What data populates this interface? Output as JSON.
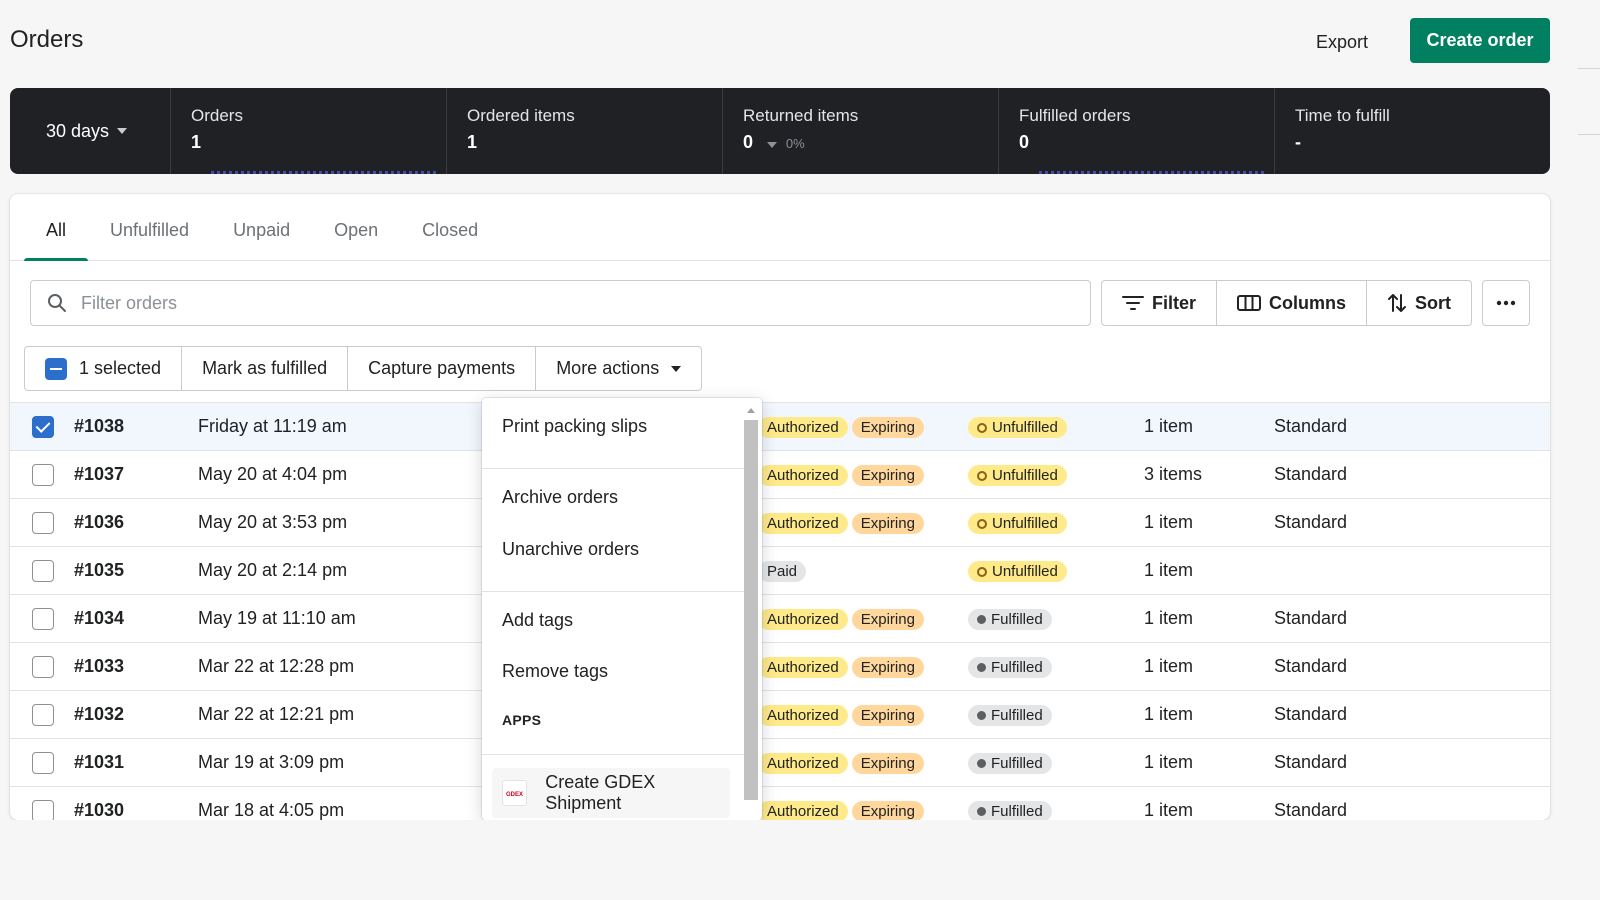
{
  "header": {
    "title": "Orders",
    "export_label": "Export",
    "create_label": "Create order"
  },
  "analytics": {
    "period": "30 days",
    "metrics": [
      {
        "label": "Orders",
        "value": "1",
        "delta": ""
      },
      {
        "label": "Ordered items",
        "value": "1",
        "delta": ""
      },
      {
        "label": "Returned items",
        "value": "0",
        "delta": "0%"
      },
      {
        "label": "Fulfilled orders",
        "value": "0",
        "delta": ""
      },
      {
        "label": "Time to fulfill",
        "value": "-",
        "delta": ""
      }
    ]
  },
  "tabs": [
    "All",
    "Unfulfilled",
    "Unpaid",
    "Open",
    "Closed"
  ],
  "search": {
    "placeholder": "Filter orders"
  },
  "toolbar": {
    "filter": "Filter",
    "columns": "Columns",
    "sort": "Sort"
  },
  "bulk": {
    "selected": "1 selected",
    "mark_fulfilled": "Mark as fulfilled",
    "capture": "Capture payments",
    "more": "More actions"
  },
  "orders": [
    {
      "id": "#1038",
      "date": "Friday at 11:19 am",
      "payment": "Authorized",
      "expiring": "Expiring",
      "fulfillment": "Unfulfilled",
      "items": "1 item",
      "delivery": "Standard",
      "checked": true
    },
    {
      "id": "#1037",
      "date": "May 20 at 4:04 pm",
      "payment": "Authorized",
      "expiring": "Expiring",
      "fulfillment": "Unfulfilled",
      "items": "3 items",
      "delivery": "Standard",
      "checked": false
    },
    {
      "id": "#1036",
      "date": "May 20 at 3:53 pm",
      "payment": "Authorized",
      "expiring": "Expiring",
      "fulfillment": "Unfulfilled",
      "items": "1 item",
      "delivery": "Standard",
      "checked": false
    },
    {
      "id": "#1035",
      "date": "May 20 at 2:14 pm",
      "payment": "Paid",
      "expiring": "",
      "fulfillment": "Unfulfilled",
      "items": "1 item",
      "delivery": "",
      "checked": false
    },
    {
      "id": "#1034",
      "date": "May 19 at 11:10 am",
      "payment": "Authorized",
      "expiring": "Expiring",
      "fulfillment": "Fulfilled",
      "items": "1 item",
      "delivery": "Standard",
      "checked": false
    },
    {
      "id": "#1033",
      "date": "Mar 22 at 12:28 pm",
      "payment": "Authorized",
      "expiring": "Expiring",
      "fulfillment": "Fulfilled",
      "items": "1 item",
      "delivery": "Standard",
      "checked": false
    },
    {
      "id": "#1032",
      "date": "Mar 22 at 12:21 pm",
      "payment": "Authorized",
      "expiring": "Expiring",
      "fulfillment": "Fulfilled",
      "items": "1 item",
      "delivery": "Standard",
      "checked": false
    },
    {
      "id": "#1031",
      "date": "Mar 19 at 3:09 pm",
      "payment": "Authorized",
      "expiring": "Expiring",
      "fulfillment": "Fulfilled",
      "items": "1 item",
      "delivery": "Standard",
      "checked": false
    },
    {
      "id": "#1030",
      "date": "Mar 18 at 4:05 pm",
      "payment": "Authorized",
      "expiring": "Expiring",
      "fulfillment": "Fulfilled",
      "items": "1 item",
      "delivery": "Standard",
      "checked": false
    }
  ],
  "dropdown": {
    "print": "Print packing slips",
    "archive": "Archive orders",
    "unarchive": "Unarchive orders",
    "add_tags": "Add tags",
    "remove_tags": "Remove tags",
    "apps_heading": "APPS",
    "gdex": "Create GDEX Shipment",
    "gdex_logo": "GDEX"
  },
  "colors": {
    "accent": "#008060",
    "selected_row": "#f2f7fe",
    "checkbox": "#2c6ecb"
  }
}
